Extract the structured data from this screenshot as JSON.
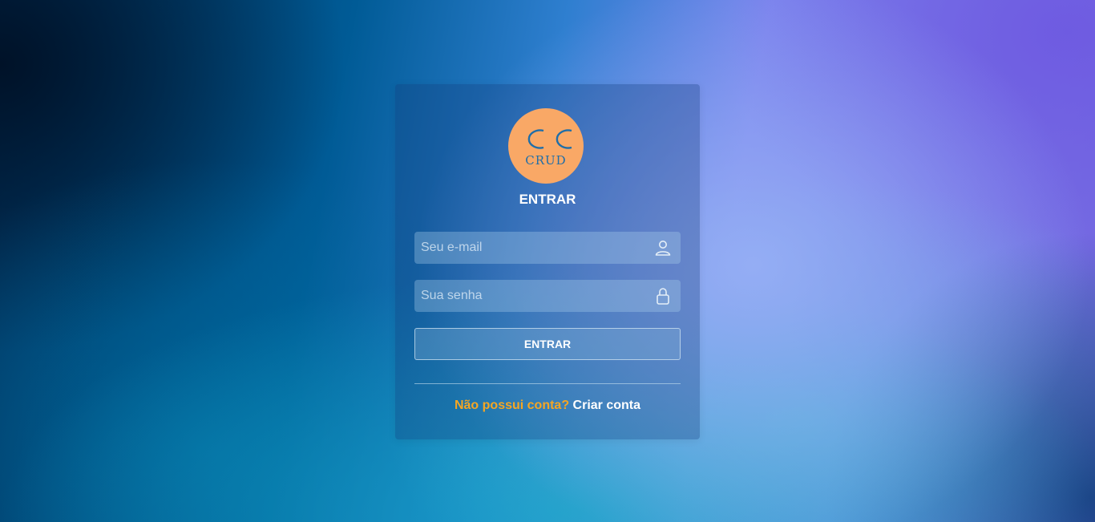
{
  "logo": {
    "text": "CRUD",
    "background_color": "#f9a866",
    "icon": "double-c-logo-icon"
  },
  "login": {
    "title": "ENTRAR",
    "email": {
      "placeholder": "Seu e-mail",
      "value": "",
      "icon": "user-icon"
    },
    "password": {
      "placeholder": "Sua senha",
      "value": "",
      "icon": "lock-icon"
    },
    "submit_label": "ENTRAR"
  },
  "signup": {
    "prompt": "Não possui conta?",
    "link_label": "Criar conta"
  },
  "colors": {
    "accent_orange": "#f5a623",
    "text_white": "#ffffff"
  }
}
